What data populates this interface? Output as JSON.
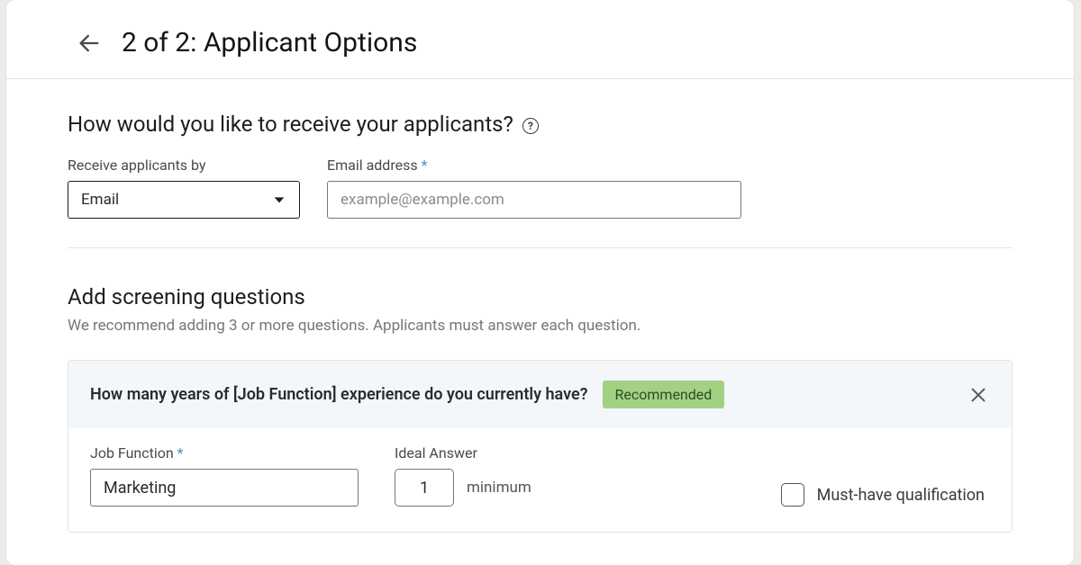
{
  "header": {
    "title": "2 of 2: Applicant Options"
  },
  "receive": {
    "heading": "How would you like to receive your applicants?",
    "by_label": "Receive applicants by",
    "by_value": "Email",
    "email_label": "Email address",
    "email_placeholder": "example@example.com",
    "email_value": ""
  },
  "screening": {
    "heading": "Add screening questions",
    "sub": "We recommend adding 3 or more questions. Applicants must answer each question.",
    "question": {
      "text": "How many years of [Job Function] experience do you currently have?",
      "badge": "Recommended",
      "job_function_label": "Job Function",
      "job_function_value": "Marketing",
      "ideal_label": "Ideal Answer",
      "ideal_value": "1",
      "ideal_suffix": "minimum",
      "must_label": "Must-have qualification",
      "must_checked": false
    }
  }
}
